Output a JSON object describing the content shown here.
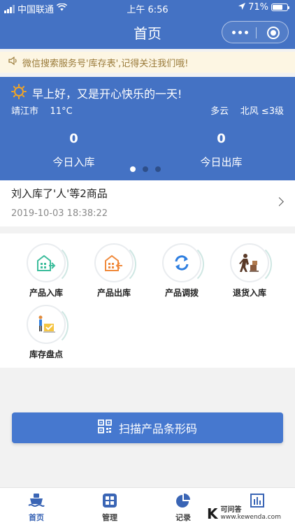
{
  "status_bar": {
    "carrier": "中国联通",
    "time": "上午 6:56",
    "battery": "71%",
    "battery_level": 0.71
  },
  "nav": {
    "title": "首页"
  },
  "notice": {
    "text": "微信搜索服务号'库存表',记得关注我们哦!"
  },
  "weather": {
    "greeting": "早上好，又是开心快乐的一天!",
    "city": "靖江市",
    "temperature": "11°C",
    "condition": "多云",
    "wind": "北风 ≤3级",
    "stats": [
      {
        "value": "0",
        "label": "今日入库"
      },
      {
        "value": "0",
        "label": "今日出库"
      }
    ],
    "pager": {
      "count": 3,
      "active_index": 0
    }
  },
  "record": {
    "title": "刘入库了'人'等2商品",
    "time": "2019-10-03 18:38:22"
  },
  "grid": {
    "items": [
      {
        "label": "产品入库",
        "icon": "warehouse-in-icon"
      },
      {
        "label": "产品出库",
        "icon": "warehouse-out-icon"
      },
      {
        "label": "产品调拨",
        "icon": "transfer-icon"
      },
      {
        "label": "退货入库",
        "icon": "return-goods-icon"
      },
      {
        "label": "库存盘点",
        "icon": "inventory-check-icon"
      }
    ]
  },
  "scan_button": {
    "label": "扫描产品条形码",
    "icon": "qr-code-icon"
  },
  "tabs": [
    {
      "label": "首页",
      "icon": "ship-icon",
      "active": true
    },
    {
      "label": "管理",
      "icon": "grid-icon",
      "active": false
    },
    {
      "label": "记录",
      "icon": "pie-chart-icon",
      "active": false
    },
    {
      "label": "",
      "icon": "chart-icon",
      "active": false
    }
  ],
  "watermark": {
    "brand": "可问答",
    "url": "www.kewenda.com"
  },
  "colors": {
    "primary": "#4472c4",
    "button": "#4678cf",
    "notice_bg": "#fdf6e3",
    "notice_text": "#9a7b3a",
    "sun": "#f5a623",
    "icon_green": "#3dbd9c",
    "icon_orange": "#f08a3c",
    "icon_blue": "#2f7fe0"
  }
}
